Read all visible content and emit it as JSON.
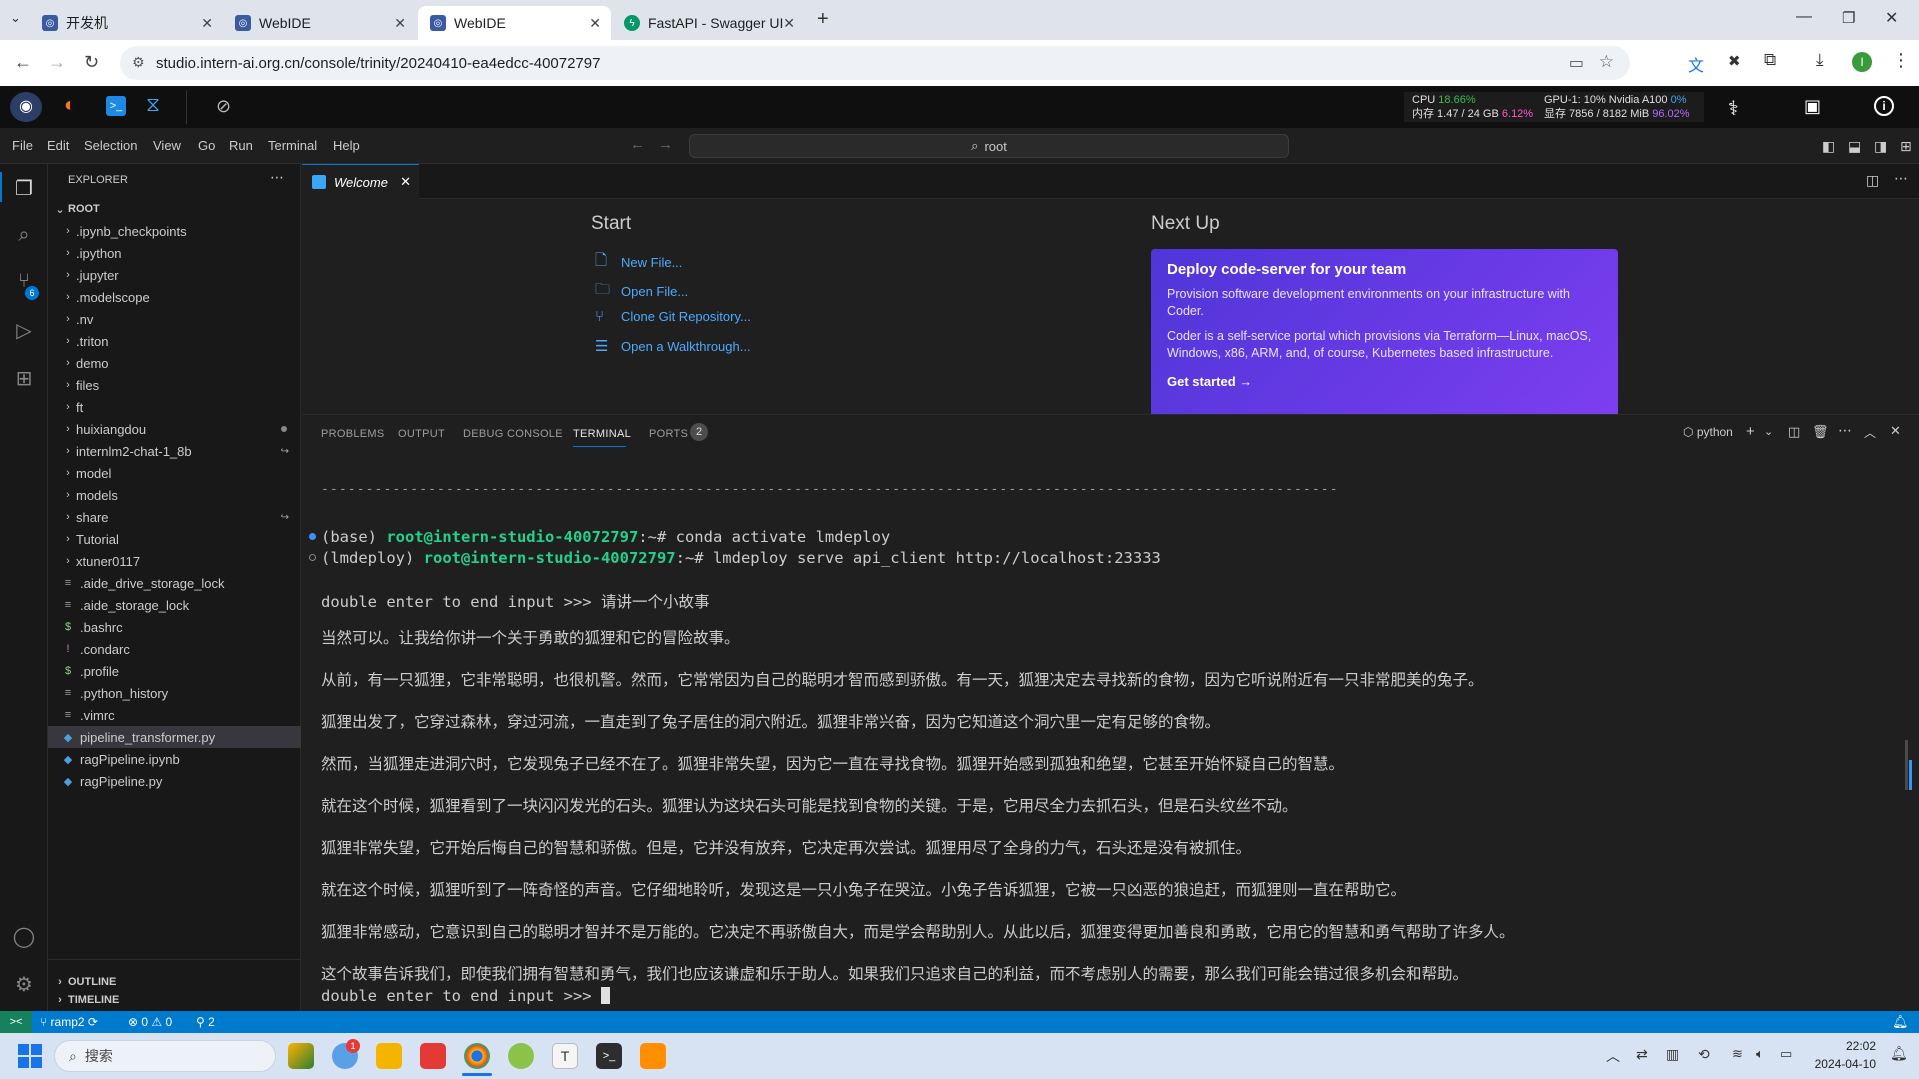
{
  "browser": {
    "tabs": [
      {
        "title": "开发机",
        "active": false
      },
      {
        "title": "WebIDE",
        "active": false
      },
      {
        "title": "WebIDE",
        "active": true
      },
      {
        "title": "FastAPI - Swagger UI",
        "active": false
      }
    ],
    "new_tab": "+",
    "url": "studio.intern-ai.org.cn/console/trinity/20240410-ea4edcc-40072797",
    "profile_initial": "I"
  },
  "studio": {
    "cpu_label": "CPU",
    "cpu_value": "18.66%",
    "mem_label": "内存 1.47 / 24 GB",
    "mem_value": "6.12%",
    "gpu_label": "GPU-1: 10% Nvidia A100",
    "gpu_value": "0%",
    "vram_label": "显存 7856 / 8182 MiB",
    "vram_value": "96.02%"
  },
  "menu": [
    "File",
    "Edit",
    "Selection",
    "View",
    "Go",
    "Run",
    "Terminal",
    "Help"
  ],
  "command_center": "root",
  "explorer": {
    "title": "EXPLORER",
    "root": "ROOT",
    "folders": [
      ".ipynb_checkpoints",
      ".ipython",
      ".jupyter",
      ".modelscope",
      ".nv",
      ".triton",
      "demo",
      "files",
      "ft",
      "huixiangdou",
      "internlm2-chat-1_8b",
      "model",
      "models",
      "share",
      "Tutorial",
      "xtuner0117"
    ],
    "files": [
      ".aide_drive_storage_lock",
      ".aide_storage_lock",
      ".bashrc",
      ".condarc",
      ".profile",
      ".python_history",
      ".vimrc",
      "pipeline_transformer.py",
      "ragPipeline.ipynb",
      "ragPipeline.py"
    ],
    "outline": "OUTLINE",
    "timeline": "TIMELINE",
    "scm_badge": "6"
  },
  "editor": {
    "tab": "Welcome",
    "start_title": "Start",
    "start_links": [
      "New File...",
      "Open File...",
      "Clone Git Repository...",
      "Open a Walkthrough..."
    ],
    "next_up": "Next Up",
    "card_title": "Deploy code-server for your team",
    "card_p1": "Provision software development environments on your infrastructure with Coder.",
    "card_p2": "Coder is a self-service portal which provisions via Terraform—Linux, macOS, Windows, x86, ARM, and, of course, Kubernetes based infrastructure.",
    "card_cta": "Get started"
  },
  "panel": {
    "tabs": [
      "PROBLEMS",
      "OUTPUT",
      "DEBUG CONSOLE",
      "TERMINAL",
      "PORTS"
    ],
    "ports_count": "2",
    "shell": "python"
  },
  "terminal": {
    "separator": "------------------------------------------------------------------------------------------------------------------",
    "cmd1_env": "(base) ",
    "cmd1_host": "root@intern-studio-40072797",
    "cmd1_rest": ":~# conda activate lmdeploy",
    "cmd2_env": "(lmdeploy) ",
    "cmd2_host": "root@intern-studio-40072797",
    "cmd2_rest": ":~# lmdeploy serve api_client http://localhost:23333",
    "prompt_line": "double enter to end input >>> 请讲一个小故事",
    "story": [
      "当然可以。让我给你讲一个关于勇敢的狐狸和它的冒险故事。",
      "从前，有一只狐狸，它非常聪明，也很机警。然而，它常常因为自己的聪明才智而感到骄傲。有一天，狐狸决定去寻找新的食物，因为它听说附近有一只非常肥美的兔子。",
      "狐狸出发了，它穿过森林，穿过河流，一直走到了兔子居住的洞穴附近。狐狸非常兴奋，因为它知道这个洞穴里一定有足够的食物。",
      "然而，当狐狸走进洞穴时，它发现兔子已经不在了。狐狸非常失望，因为它一直在寻找食物。狐狸开始感到孤独和绝望，它甚至开始怀疑自己的智慧。",
      "就在这个时候，狐狸看到了一块闪闪发光的石头。狐狸认为这块石头可能是找到食物的关键。于是，它用尽全力去抓石头，但是石头纹丝不动。",
      "狐狸非常失望，它开始后悔自己的智慧和骄傲。但是，它并没有放弃，它决定再次尝试。狐狸用尽了全身的力气，石头还是没有被抓住。",
      "就在这个时候，狐狸听到了一阵奇怪的声音。它仔细地聆听，发现这是一只小兔子在哭泣。小兔子告诉狐狸，它被一只凶恶的狼追赶，而狐狸则一直在帮助它。",
      "狐狸非常感动，它意识到自己的聪明才智并不是万能的。它决定不再骄傲自大，而是学会帮助别人。从此以后，狐狸变得更加善良和勇敢，它用它的智慧和勇气帮助了许多人。",
      "这个故事告诉我们，即使我们拥有智慧和勇气，我们也应该谦虚和乐于助人。如果我们只追求自己的利益，而不考虑别人的需要，那么我们可能会错过很多机会和帮助。"
    ],
    "last_prompt": "double enter to end input >>> "
  },
  "status": {
    "remote": "ramp2",
    "errors": "0",
    "warnings": "0",
    "ports": "2"
  },
  "taskbar": {
    "search": "搜索",
    "time": "22:02",
    "date": "2024-04-10",
    "badge": "1"
  },
  "colors": {
    "accent": "#0078d4",
    "statusbar": "#007acc",
    "host": "#23d18b",
    "cpu": "#3fb950",
    "mem": "#ff5ac8"
  }
}
